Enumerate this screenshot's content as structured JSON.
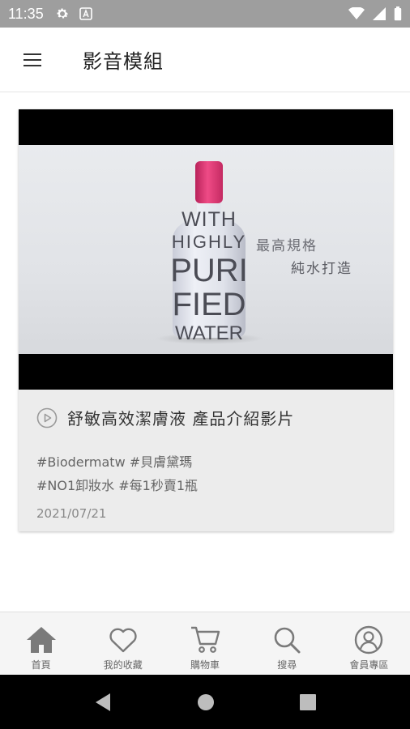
{
  "status_bar": {
    "time": "11:35",
    "icons": [
      "settings-icon",
      "keyboard-icon",
      "wifi-icon",
      "signal-icon",
      "battery-icon"
    ]
  },
  "app_bar": {
    "menu_icon": "menu-icon",
    "title": "影音模組"
  },
  "video_card": {
    "image_text": {
      "bottle_lines": [
        "WITH",
        "HIGHLY",
        "PURI",
        "FIED",
        "WATER"
      ],
      "overlay_line1": "最高規格",
      "overlay_line2": "純水打造"
    },
    "play_icon": "play-circle-icon",
    "title": "舒敏高效潔膚液 產品介紹影片",
    "tags_line1": "#Biodermatw #貝膚黛瑪",
    "tags_line2": "#NO1卸妝水 #每1秒賣1瓶",
    "date": "2021/07/21"
  },
  "bottom_nav": {
    "items": [
      {
        "label": "首頁",
        "icon": "home-icon",
        "active": true
      },
      {
        "label": "我的收藏",
        "icon": "heart-icon",
        "active": false
      },
      {
        "label": "購物車",
        "icon": "cart-icon",
        "active": false
      },
      {
        "label": "搜尋",
        "icon": "search-icon",
        "active": false
      },
      {
        "label": "會員專區",
        "icon": "user-icon",
        "active": false
      }
    ]
  },
  "system_nav": {
    "icons": [
      "back-icon",
      "home-circle-icon",
      "recents-icon"
    ]
  },
  "colors": {
    "status_bar": "#9e9e9e",
    "bottle_cap": "#e23a77",
    "bottom_nav_bg": "#f5f5f5",
    "card_bg": "#ececec",
    "icon_color": "#7a7a7a"
  }
}
